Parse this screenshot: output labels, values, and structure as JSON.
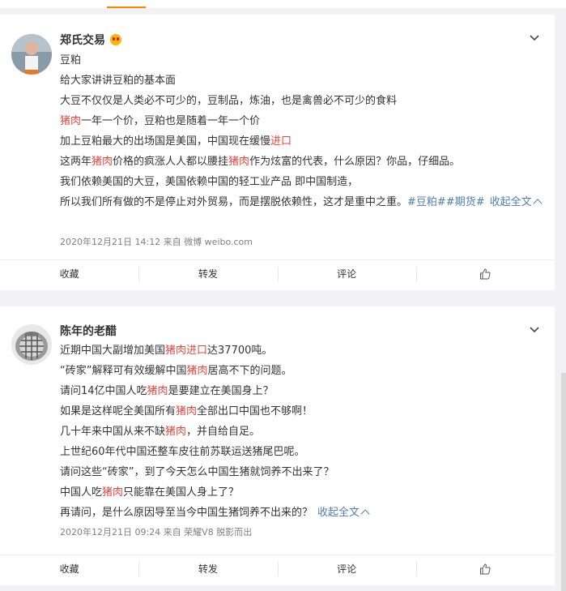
{
  "posts": [
    {
      "author": "郑氏交易",
      "emoji_icon": "smiling-face-icon",
      "lines": [
        [
          {
            "t": "豆粕"
          }
        ],
        [
          {
            "t": "给大家讲讲豆粕的基本面"
          }
        ],
        [
          {
            "t": "大豆不仅仅是人类必不可少的，豆制品，炼油，也是禽兽必不可少的食料"
          }
        ],
        [
          {
            "t": "猪肉",
            "h": true
          },
          {
            "t": "一年一个价，豆粕也是随着一年一个价"
          }
        ],
        [
          {
            "t": "加上豆粕最大的出场国是美国，中国现在缓慢"
          },
          {
            "t": "进口",
            "h": true
          }
        ],
        [
          {
            "t": "这两年"
          },
          {
            "t": "猪肉",
            "h": true
          },
          {
            "t": "价格的疯涨人人都以腰挂"
          },
          {
            "t": "猪肉",
            "h": true
          },
          {
            "t": "作为炫富的代表，什么原因？你品，仔细品。"
          }
        ],
        [
          {
            "t": "我们依赖美国的大豆，美国依赖中国的轻工业产品 即中国制造，"
          }
        ]
      ],
      "last_line": "所以我们所有做的不是停止对外贸易，而是摆脱依赖性，这才是重中之重。",
      "tags": "#豆粕##期货#",
      "collapse_label": "收起全文",
      "meta": "2020年12月21日 14:12  来自 微博 weibo.com",
      "actions": {
        "favorite": "收藏",
        "repost": "转发",
        "comment": "评论"
      }
    },
    {
      "author": "陈年的老醋",
      "lines": [
        [
          {
            "t": "近期中国大副增加美国"
          },
          {
            "t": "猪肉进口",
            "h": true
          },
          {
            "t": "达37700吨。"
          }
        ],
        [
          {
            "t": "“砖家”解释可有效缓解中国"
          },
          {
            "t": "猪肉",
            "h": true
          },
          {
            "t": "居高不下的问题。"
          }
        ],
        [
          {
            "t": "请问14亿中国人吃"
          },
          {
            "t": "猪肉",
            "h": true
          },
          {
            "t": "是要建立在美国身上？"
          }
        ],
        [
          {
            "t": "如果是这样呢全美国所有"
          },
          {
            "t": "猪肉",
            "h": true
          },
          {
            "t": "全部出口中国也不够啊！"
          }
        ],
        [
          {
            "t": "几十年来中国从来不缺"
          },
          {
            "t": "猪肉",
            "h": true
          },
          {
            "t": "，并自给自足。"
          }
        ],
        [
          {
            "t": "上世纪60年代中国还整车皮往前苏联运送猪尾巴呢。"
          }
        ],
        [
          {
            "t": "请问这些“砖家”，到了今天怎么中国生猪就饲养不出来了？"
          }
        ],
        [
          {
            "t": "中国人吃"
          },
          {
            "t": "猪肉",
            "h": true
          },
          {
            "t": "只能靠在美国人身上了？"
          }
        ]
      ],
      "last_line": "再请问，是什么原因导至当今中国生猪饲养不出来的？",
      "tags": "",
      "collapse_label": "收起全文",
      "meta": "2020年12月21日 09:24  来自 荣耀V8 脱影而出",
      "actions": {
        "favorite": "收藏",
        "repost": "转发",
        "comment": "评论"
      }
    }
  ],
  "icons": {
    "menu": "chevron-down-icon",
    "like": "thumbs-up-icon",
    "collapse": "chevron-up-icon"
  },
  "colors": {
    "highlight": "#e8453c",
    "link": "#507daf",
    "accent": "#ff8200"
  }
}
